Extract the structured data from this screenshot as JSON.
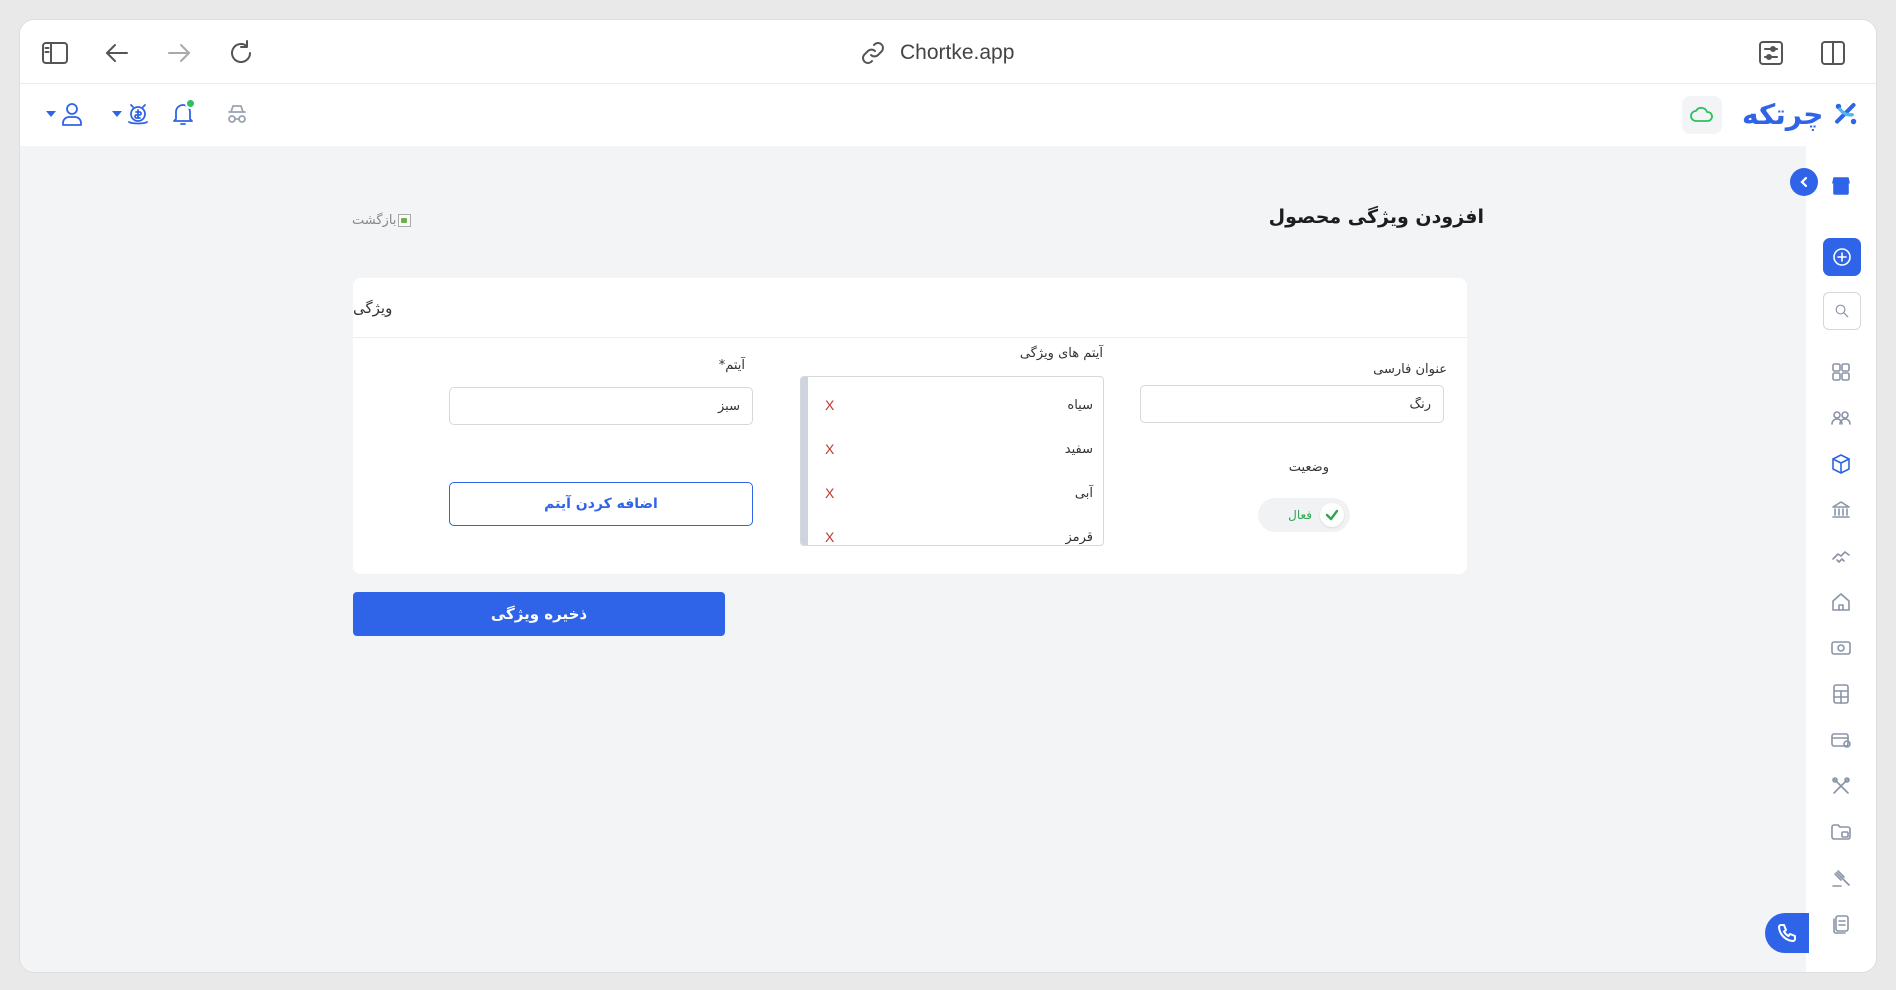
{
  "browser": {
    "url": "Chortke.app"
  },
  "header": {
    "brand_name": "چرتکه"
  },
  "page": {
    "title": "افزودن ویژگی محصول",
    "back_label": "بازگشت"
  },
  "card": {
    "title": "ویژگی",
    "persian_title_label": "عنوان فارسی",
    "persian_title_value": "رنگ",
    "status_label": "وضعیت",
    "status_value": "فعال",
    "items_label": "آیتم های ویژگی",
    "items": [
      {
        "value": "سیاه",
        "remove": "X"
      },
      {
        "value": "سفید",
        "remove": "X"
      },
      {
        "value": "آبی",
        "remove": "X"
      },
      {
        "value": "قرمز",
        "remove": "X"
      }
    ],
    "item_label": "آیتم*",
    "item_value": "سبز",
    "add_item_label": "اضافه کردن آیتم"
  },
  "actions": {
    "save_label": "ذخیره ویژگی"
  },
  "colors": {
    "accent": "#2f64e8",
    "success": "#2fbf5c",
    "danger": "#c0392b",
    "background": "#f3f4f6"
  }
}
